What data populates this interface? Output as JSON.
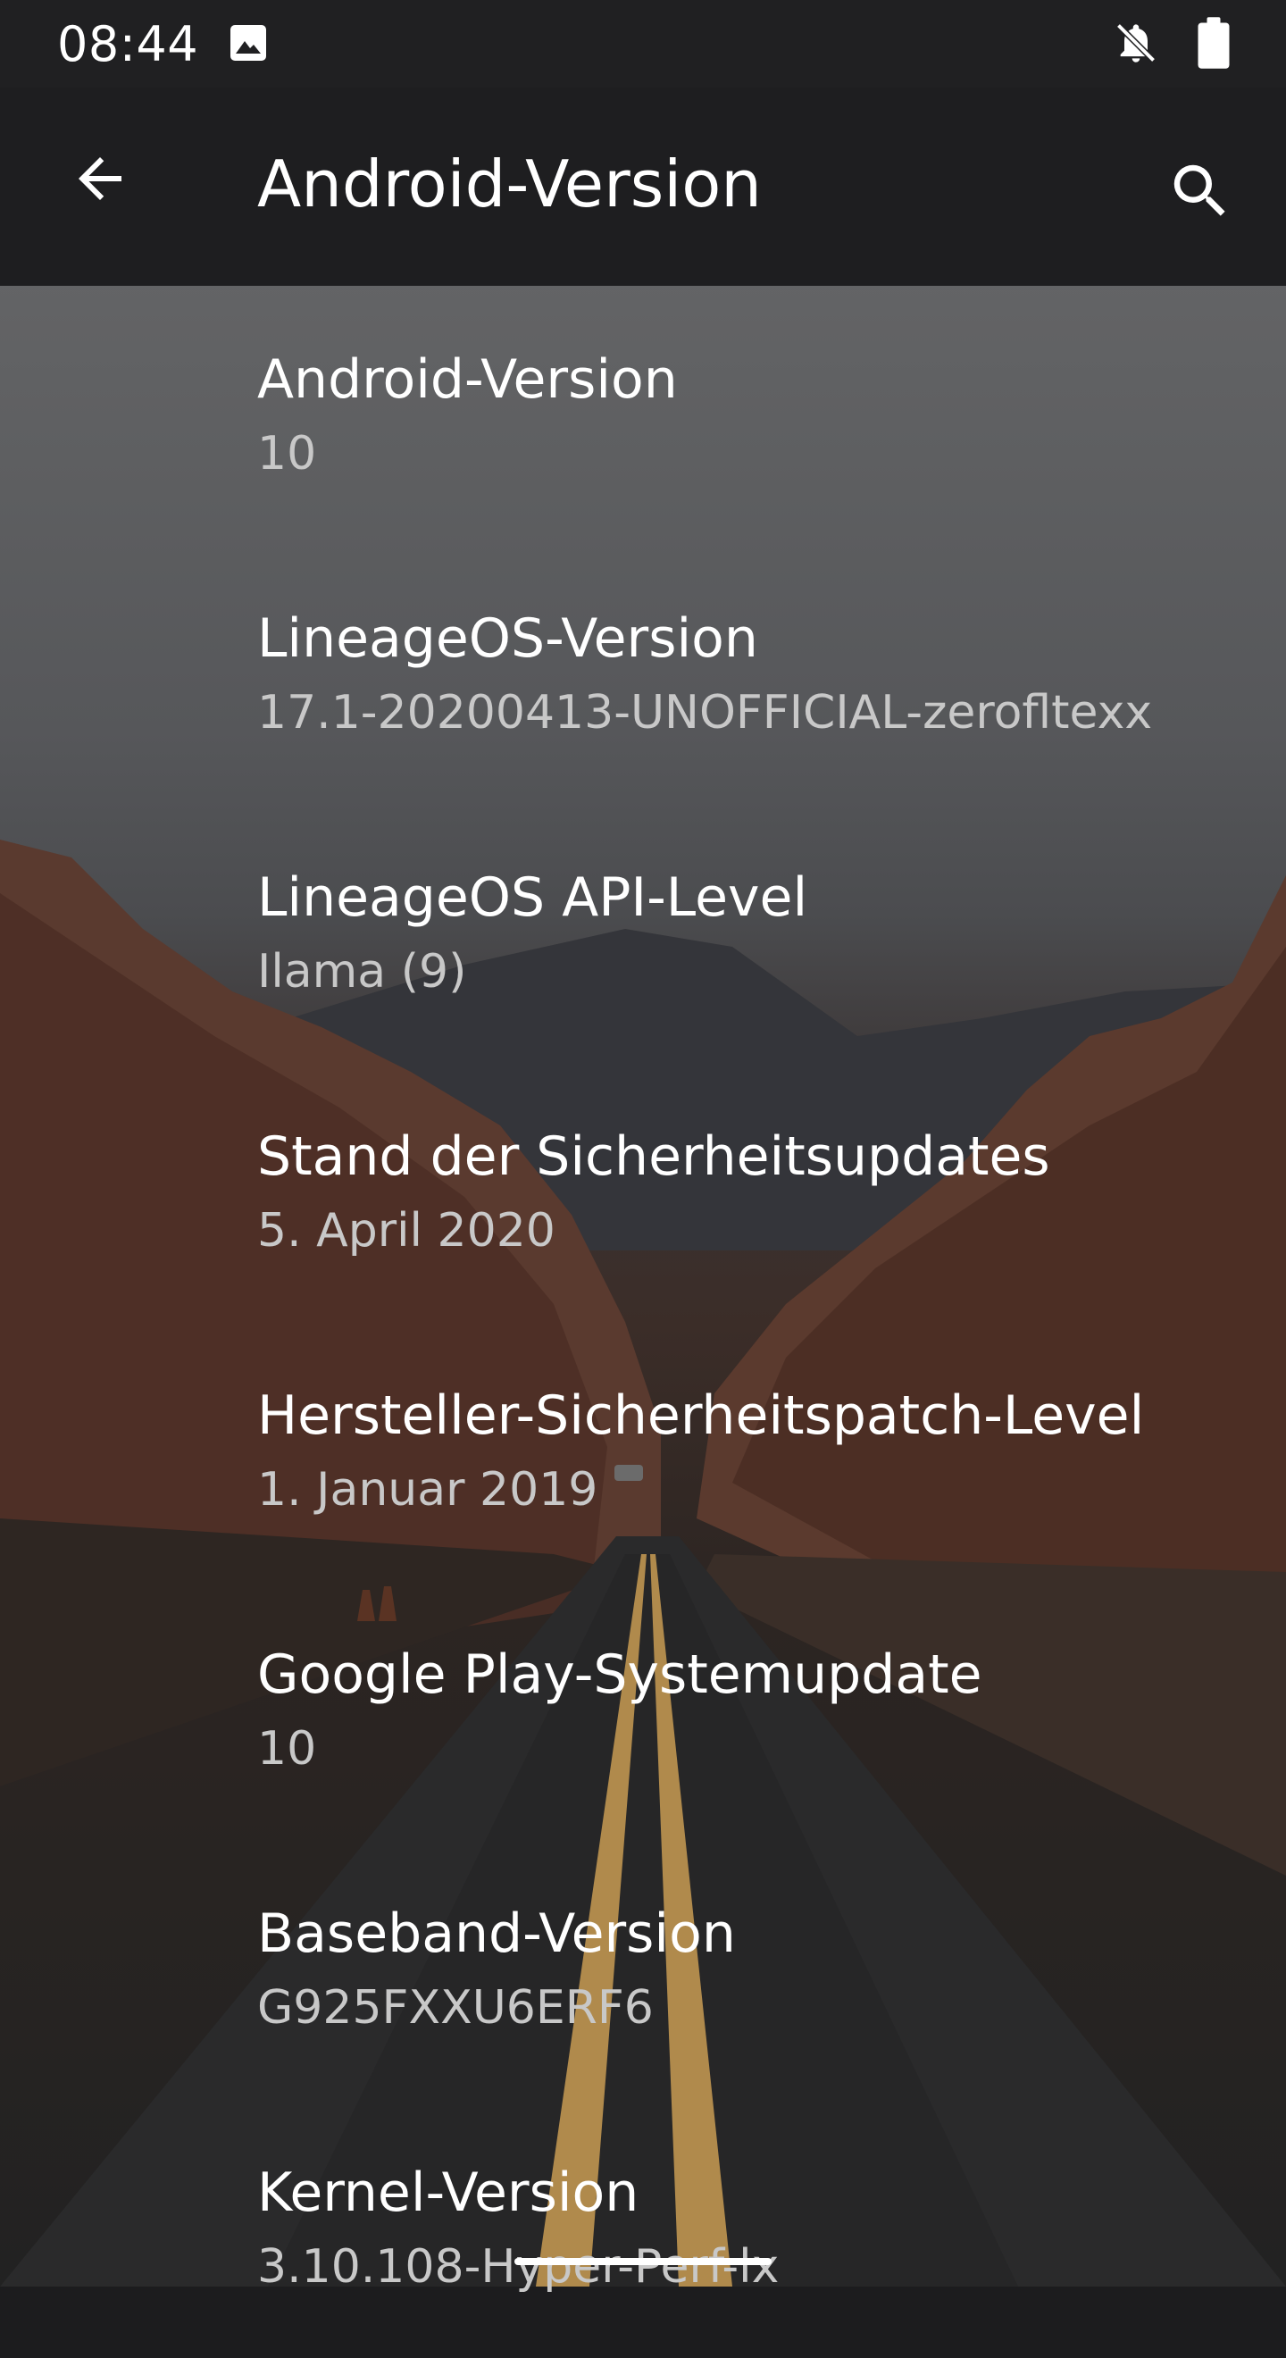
{
  "status_bar": {
    "time": "08:44",
    "icons": [
      "image-icon",
      "notifications-off-icon",
      "battery-icon"
    ]
  },
  "app_bar": {
    "title": "Android-Version",
    "back_icon": "arrow-back-icon",
    "search_icon": "search-icon"
  },
  "settings": [
    {
      "title": "Android-Version",
      "value": "10"
    },
    {
      "title": "LineageOS-Version",
      "value": "17.1-20200413-UNOFFICIAL-zerofltexx"
    },
    {
      "title": "LineageOS API-Level",
      "value": "Ilama (9)"
    },
    {
      "title": "Stand der Sicherheitsupdates",
      "value": "5. April 2020"
    },
    {
      "title": "Hersteller-Sicherheitspatch-Level",
      "value": "1. Januar 2019"
    },
    {
      "title": "Google Play-Systemupdate",
      "value": "10"
    },
    {
      "title": "Baseband-Version",
      "value": "G925FXXU6ERF6"
    },
    {
      "title": "Kernel-Version",
      "value": "3.10.108-Hyper-Perf-lx"
    }
  ],
  "colors": {
    "status_bar_bg": "#202022",
    "app_bar_bg": "#1e1e20",
    "title_text": "#ffffff",
    "value_text": "#c8c8c8"
  }
}
